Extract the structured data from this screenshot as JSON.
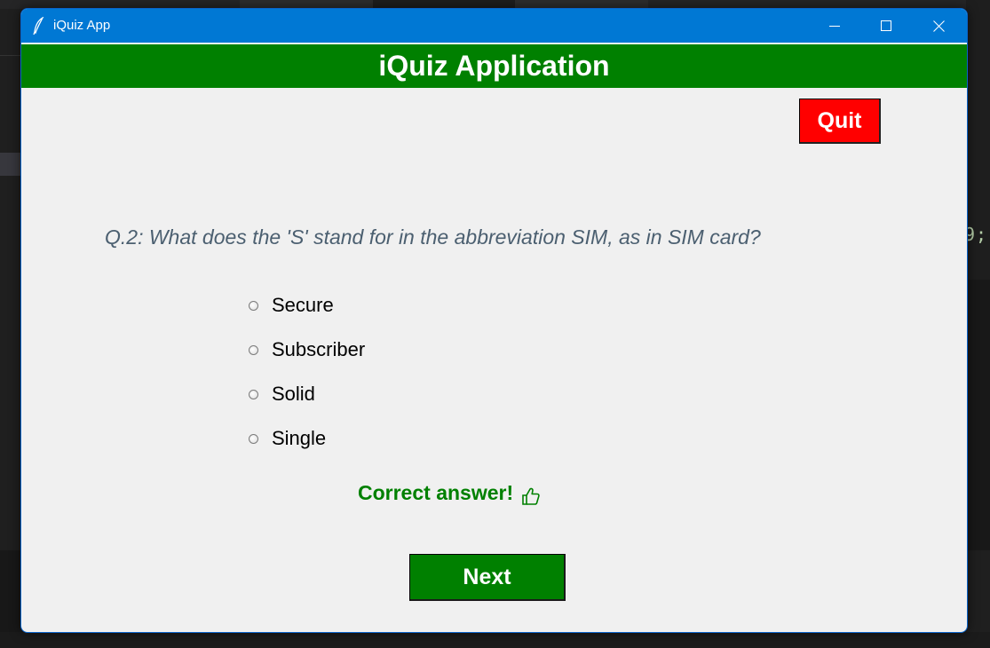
{
  "window": {
    "title": "iQuiz App",
    "icon": "feather-icon"
  },
  "header": {
    "title": "iQuiz Application",
    "color": "#008000"
  },
  "quit": {
    "label": "Quit",
    "color": "#ff0000"
  },
  "question": {
    "text": "Q.2: What does the 'S' stand for in the abbreviation SIM, as in SIM card?"
  },
  "options": [
    {
      "label": "Secure"
    },
    {
      "label": "Subscriber"
    },
    {
      "label": "Solid"
    },
    {
      "label": "Single"
    }
  ],
  "feedback": {
    "text": "Correct answer!",
    "icon": "thumbs-up-icon",
    "color": "#008000"
  },
  "next": {
    "label": "Next",
    "color": "#008000"
  },
  "background": {
    "code_fragment": "9;"
  }
}
